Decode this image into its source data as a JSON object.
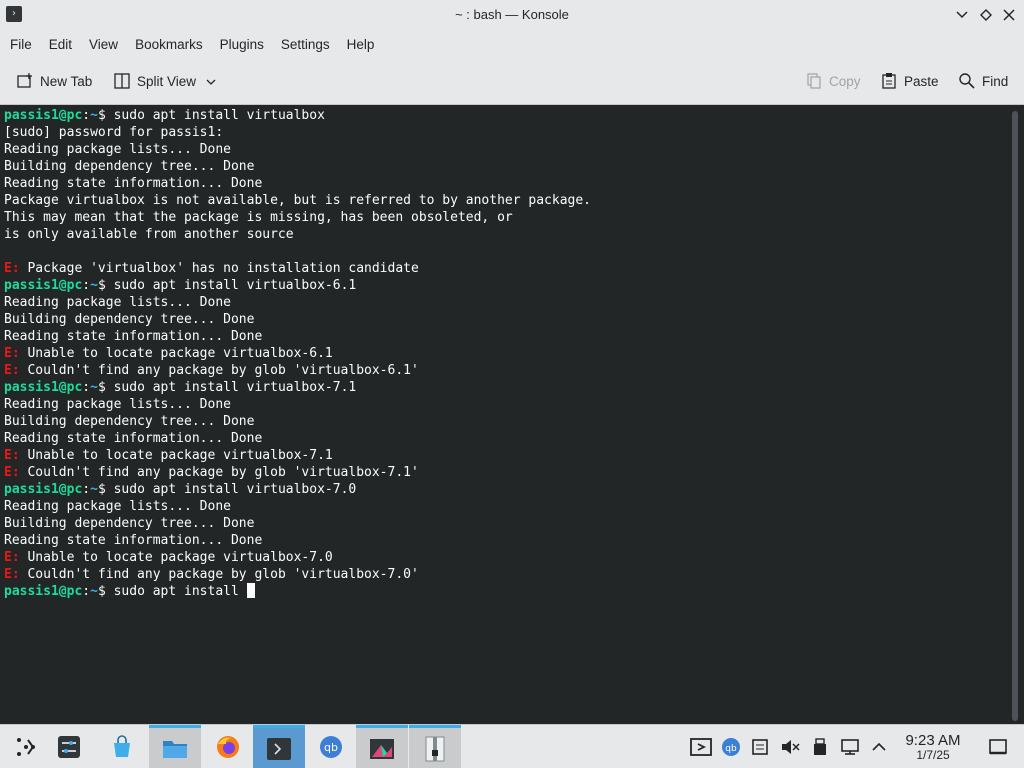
{
  "window": {
    "title": "~ : bash — Konsole",
    "app_icon_glyph": "›"
  },
  "menubar": {
    "items": [
      "File",
      "Edit",
      "View",
      "Bookmarks",
      "Plugins",
      "Settings",
      "Help"
    ]
  },
  "toolbar": {
    "new_tab": "New Tab",
    "split_view": "Split View",
    "copy": "Copy",
    "paste": "Paste",
    "find": "Find"
  },
  "terminal": {
    "prompt_user": "passis1@pc",
    "prompt_path": "~",
    "prompt_suffix": "$ ",
    "lines": [
      {
        "kind": "prompt",
        "text": "sudo apt install virtualbox"
      },
      {
        "kind": "out",
        "text": "[sudo] password for passis1:"
      },
      {
        "kind": "out",
        "text": "Reading package lists... Done"
      },
      {
        "kind": "out",
        "text": "Building dependency tree... Done"
      },
      {
        "kind": "out",
        "text": "Reading state information... Done"
      },
      {
        "kind": "out",
        "text": "Package virtualbox is not available, but is referred to by another package."
      },
      {
        "kind": "out",
        "text": "This may mean that the package is missing, has been obsoleted, or"
      },
      {
        "kind": "out",
        "text": "is only available from another source"
      },
      {
        "kind": "out",
        "text": ""
      },
      {
        "kind": "err",
        "text": "Package 'virtualbox' has no installation candidate"
      },
      {
        "kind": "prompt",
        "text": "sudo apt install virtualbox-6.1"
      },
      {
        "kind": "out",
        "text": "Reading package lists... Done"
      },
      {
        "kind": "out",
        "text": "Building dependency tree... Done"
      },
      {
        "kind": "out",
        "text": "Reading state information... Done"
      },
      {
        "kind": "err",
        "text": "Unable to locate package virtualbox-6.1"
      },
      {
        "kind": "err",
        "text": "Couldn't find any package by glob 'virtualbox-6.1'"
      },
      {
        "kind": "prompt",
        "text": "sudo apt install virtualbox-7.1"
      },
      {
        "kind": "out",
        "text": "Reading package lists... Done"
      },
      {
        "kind": "out",
        "text": "Building dependency tree... Done"
      },
      {
        "kind": "out",
        "text": "Reading state information... Done"
      },
      {
        "kind": "err",
        "text": "Unable to locate package virtualbox-7.1"
      },
      {
        "kind": "err",
        "text": "Couldn't find any package by glob 'virtualbox-7.1'"
      },
      {
        "kind": "prompt",
        "text": "sudo apt install virtualbox-7.0"
      },
      {
        "kind": "out",
        "text": "Reading package lists... Done"
      },
      {
        "kind": "out",
        "text": "Building dependency tree... Done"
      },
      {
        "kind": "out",
        "text": "Reading state information... Done"
      },
      {
        "kind": "err",
        "text": "Unable to locate package virtualbox-7.0"
      },
      {
        "kind": "err",
        "text": "Couldn't find any package by glob 'virtualbox-7.0'"
      },
      {
        "kind": "current",
        "text": "sudo apt install "
      }
    ],
    "error_prefix": "E: "
  },
  "taskbar": {
    "clock_time": "9:23 AM",
    "clock_date": "1/7/25"
  },
  "colors": {
    "prompt_user": "#1cdc9a",
    "prompt_path": "#3daee9",
    "error": "#ed1515",
    "terminal_bg": "#232627",
    "chrome_bg": "#e7e8ea"
  }
}
